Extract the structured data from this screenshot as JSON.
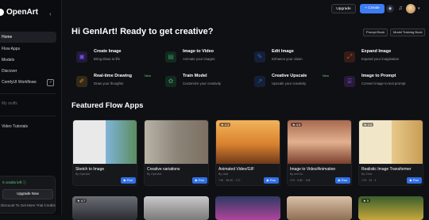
{
  "sidebar": {
    "brand": "OpenArt",
    "collapse_icon": "chevron-left",
    "items": [
      {
        "label": "Home",
        "active": true
      },
      {
        "label": "Flow Apps",
        "active": false
      },
      {
        "label": "Models",
        "active": false
      },
      {
        "label": "Discover",
        "active": false
      },
      {
        "label": "ComfyUI Workflows",
        "active": false
      }
    ],
    "my_stuff": "My stuffs",
    "video_tutorials": "Video Tutorials",
    "credits_text": "0 credits left ⓘ",
    "upgrade_label": "Upgrade Now",
    "discount_text": "Discount To Get More Trial Credits"
  },
  "topbar": {
    "upgrade_label": "Upgrade",
    "create_label": "+ Create",
    "discord_icon": "discord-icon",
    "bell_icon": "bell-icon"
  },
  "greeting": "Hi GenIArt! Ready to get creative?",
  "chips": [
    "Prompt Book",
    "Model Training Book"
  ],
  "tools": [
    {
      "title": "Create Image",
      "sub": "Bring ideas to life",
      "new": "",
      "icon": "image-icon",
      "color": "#6b4bd8",
      "glyph": "▣"
    },
    {
      "title": "Image to Video",
      "sub": "Animate your images",
      "new": "",
      "icon": "video-icon",
      "color": "#2f8f5a",
      "glyph": "▤"
    },
    {
      "title": "Edit Image",
      "sub": "Enhance your vision",
      "new": "",
      "icon": "edit-icon",
      "color": "#2d63c8",
      "glyph": "✎"
    },
    {
      "title": "Expand Image",
      "sub": "Expand your imagination",
      "new": "",
      "icon": "expand-icon",
      "color": "#c8542d",
      "glyph": "⤢"
    },
    {
      "title": "Real-time Drawing",
      "sub": "Draw your thoughts",
      "new": "New",
      "icon": "brush-icon",
      "color": "#c8902d",
      "glyph": "✐"
    },
    {
      "title": "Train Model",
      "sub": "Customize your creativity",
      "new": "",
      "icon": "model-icon",
      "color": "#2f8f5a",
      "glyph": "✿"
    },
    {
      "title": "Creative Upscale",
      "sub": "Upscale your creativity",
      "new": "New",
      "icon": "upscale-icon",
      "color": "#2d63c8",
      "glyph": "↗"
    },
    {
      "title": "Image to Prompt",
      "sub": "Convert image to text prompt",
      "new": "",
      "icon": "prompt-icon",
      "color": "#8a4bd8",
      "glyph": "⌸"
    }
  ],
  "section_title": "Featured Flow Apps",
  "cards": [
    {
      "title": "Sketch to Image",
      "by": "By OpenArt",
      "rating": "",
      "stats": "",
      "run": "▶ Run",
      "bg": "linear-gradient(90deg,#e9e9e9 0%,#e9e9e9 50%,#7fb5d9 50%,#5a8a5a 100%)"
    },
    {
      "title": "Creative variations",
      "by": "By OpenArt",
      "rating": "",
      "stats": "",
      "run": "▶ Run",
      "bg": "linear-gradient(90deg,#b9b2a6 0%,#8c8478 50%,#7b6f61 100%)"
    },
    {
      "title": "Animated Video/GIF",
      "by": "By vioia",
      "rating": "★ 4.3",
      "stats": "74K  ·  38.9K  ·  172",
      "run": "▶ Run",
      "bg": "linear-gradient(180deg,#f2b35a 0%,#d9812e 55%,#6e3a1c 100%)"
    },
    {
      "title": "Image to Video/Animation",
      "by": "By neil.f.tu",
      "rating": "★ 4.5",
      "stats": "27K  ·  8.8K  ·  108",
      "run": "▶ Run",
      "bg": "linear-gradient(180deg,#a86a50 0%,#e2b08f 50%,#7a3f2c 100%)"
    },
    {
      "title": "Realistic Image Transformer",
      "by": "By Chris",
      "rating": "★ 4.6",
      "stats": "17K  ·  43  ·  4",
      "run": "▶ Run",
      "bg": "linear-gradient(90deg,#f1e6c8 0%,#f1e6c8 50%,#e7c98a 50%,#c79a54 100%)"
    }
  ],
  "row2": [
    {
      "rating": "★ 4.7",
      "bg": "linear-gradient(180deg,#6a6e75,#2a2c31)"
    },
    {
      "rating": "",
      "bg": "linear-gradient(180deg,#c9c9c9,#7a7a7a)"
    },
    {
      "rating": "",
      "bg": "linear-gradient(180deg,#2d3a63,#b0449b)"
    },
    {
      "rating": "",
      "bg": "linear-gradient(180deg,#d8c1a8,#8f6f54)"
    },
    {
      "rating": "★ 5",
      "bg": "linear-gradient(180deg,#3a5e2c,#c7a83a)"
    }
  ]
}
